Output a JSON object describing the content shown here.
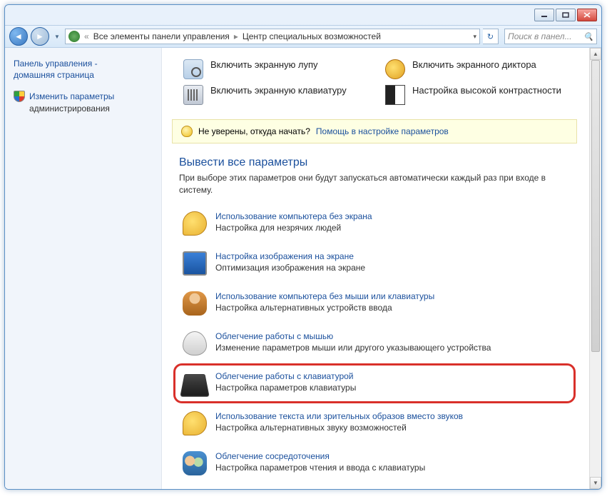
{
  "titlebar": {},
  "addressbar": {
    "crumb1": "Все элементы панели управления",
    "crumb2": "Центр специальных возможностей",
    "search_placeholder": "Поиск в панел..."
  },
  "sidebar": {
    "home1": "Панель управления -",
    "home2": "домашняя страница",
    "admin1": "Изменить параметры",
    "admin2": "администрирования"
  },
  "quick": {
    "magnifier": "Включить экранную лупу",
    "narrator": "Включить экранного диктора",
    "keyboard": "Включить экранную клавиатуру",
    "contrast": "Настройка высокой контрастности"
  },
  "help": {
    "prompt": "Не уверены, откуда начать?",
    "link": "Помощь в настройке параметров"
  },
  "section": {
    "heading": "Вывести все параметры",
    "sub": "При выборе этих параметров они будут запускаться автоматически каждый раз при входе в систему."
  },
  "items": [
    {
      "title": "Использование компьютера без экрана",
      "desc": "Настройка для незрячих людей",
      "icon": "chat",
      "hl": false
    },
    {
      "title": "Настройка изображения на экране",
      "desc": "Оптимизация изображения на экране",
      "icon": "monitor",
      "hl": false
    },
    {
      "title": "Использование компьютера без мыши или клавиатуры",
      "desc": "Настройка альтернативных устройств ввода",
      "icon": "person",
      "hl": false
    },
    {
      "title": "Облегчение работы с мышью",
      "desc": "Изменение параметров мыши или другого указывающего устройства",
      "icon": "mouse",
      "hl": false
    },
    {
      "title": "Облегчение работы с клавиатурой",
      "desc": "Настройка параметров клавиатуры",
      "icon": "kb2",
      "hl": true
    },
    {
      "title": "Использование текста или зрительных образов вместо звуков",
      "desc": "Настройка альтернативных звуку возможностей",
      "icon": "chat",
      "hl": false
    },
    {
      "title": "Облегчение сосредоточения",
      "desc": "Настройка параметров чтения и ввода с клавиатуры",
      "icon": "people",
      "hl": false
    }
  ]
}
